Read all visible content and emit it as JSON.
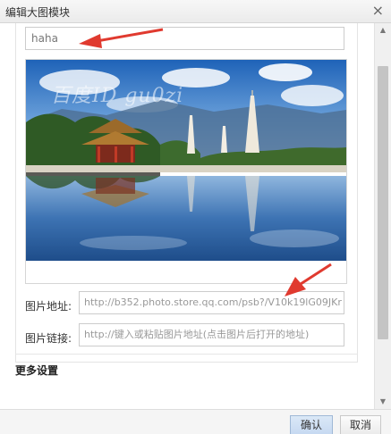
{
  "window": {
    "title": "编辑大图模块",
    "close_glyph": "×"
  },
  "form": {
    "name_value": "haha",
    "image_url_label": "图片地址:",
    "image_url_value": "http://b352.photo.store.qq.com/psb?/V10k19lG09JKr",
    "image_link_label": "图片链接:",
    "image_link_placeholder": "http://键入或粘贴图片地址(点击图片后打开的地址)"
  },
  "preview": {
    "watermark_text": "百度ID gu0zi"
  },
  "more_settings_label": "更多设置",
  "footer": {
    "ok_label": "确认",
    "cancel_label": "取消"
  },
  "colors": {
    "annotation_arrow": "#e03a2f",
    "accent_button": "#c6d9f1"
  },
  "icons": {
    "close": "close-icon",
    "scroll_up": "scroll-up-icon",
    "scroll_down": "scroll-down-icon"
  }
}
